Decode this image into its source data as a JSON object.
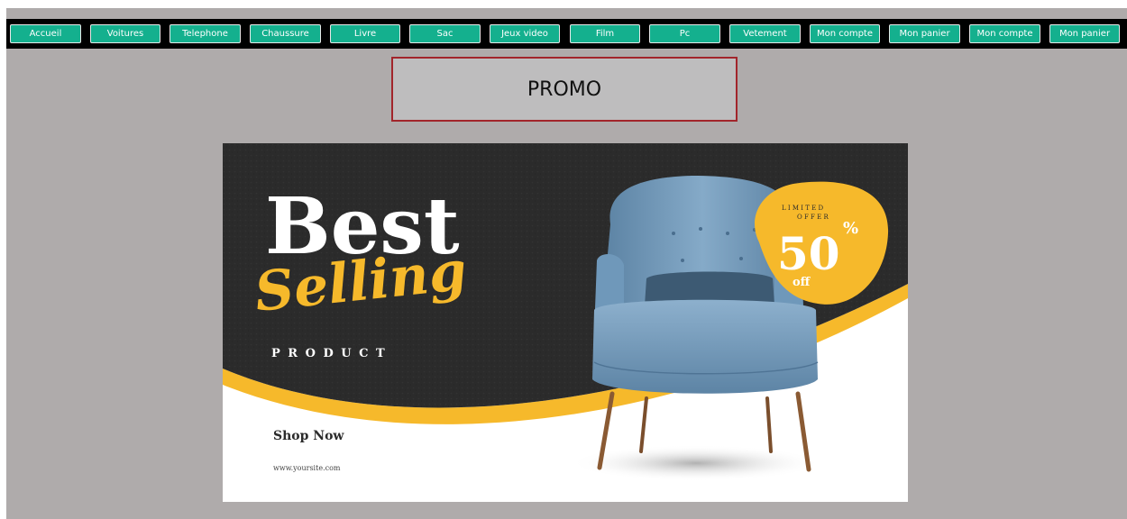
{
  "nav": {
    "items": [
      {
        "label": "Accueil"
      },
      {
        "label": "Voitures"
      },
      {
        "label": "Telephone"
      },
      {
        "label": "Chaussure"
      },
      {
        "label": "Livre"
      },
      {
        "label": "Sac"
      },
      {
        "label": "Jeux video"
      },
      {
        "label": "Film"
      },
      {
        "label": "Pc"
      },
      {
        "label": "Vetement"
      },
      {
        "label": "Mon compte"
      },
      {
        "label": "Mon panier"
      },
      {
        "label": "Mon compte"
      },
      {
        "label": "Mon panier"
      }
    ]
  },
  "promo": {
    "label": "PROMO"
  },
  "banner": {
    "headline_1": "Best",
    "headline_2": "Selling",
    "subhead": "P R O D U C T",
    "badge_top_1": "L I M I T E D",
    "badge_top_2": "O F F E R",
    "badge_value": "50",
    "badge_percent": "%",
    "badge_off": "off",
    "cta": "Shop Now",
    "website": "www.yoursite.com"
  },
  "colors": {
    "page_bg": "#afabab",
    "navbar_bg": "#000000",
    "nav_button": "#14b08e",
    "promo_bg": "#bebdbe",
    "promo_border": "#a2252b",
    "banner_dark": "#2b2b2b",
    "banner_accent": "#f6b92b",
    "chair": "#6d96b8"
  }
}
